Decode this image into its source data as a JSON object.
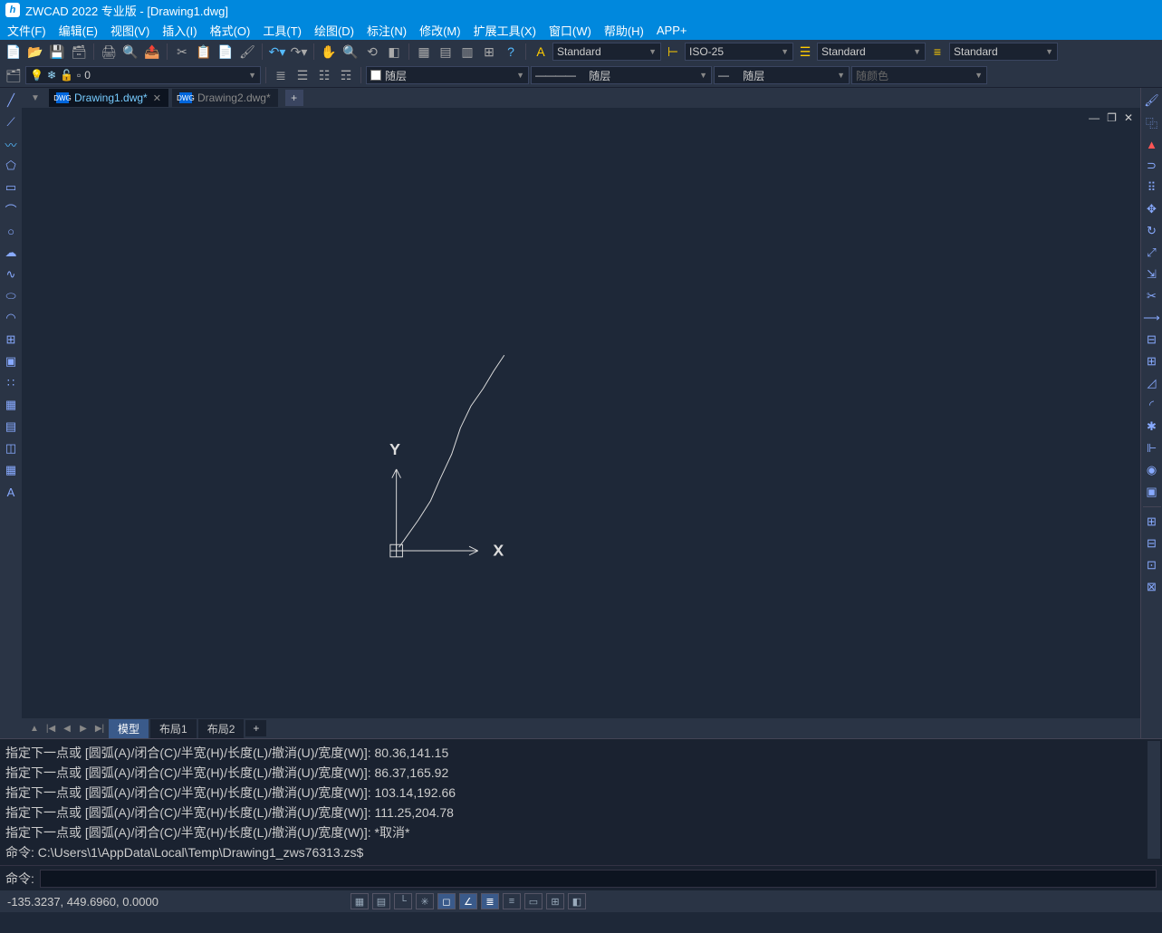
{
  "title": "ZWCAD 2022 专业版 - [Drawing1.dwg]",
  "app_initial": "h",
  "menu": [
    "文件(F)",
    "编辑(E)",
    "视图(V)",
    "插入(I)",
    "格式(O)",
    "工具(T)",
    "绘图(D)",
    "标注(N)",
    "修改(M)",
    "扩展工具(X)",
    "窗口(W)",
    "帮助(H)",
    "APP+"
  ],
  "style_dd1": "Standard",
  "style_dd2": "ISO-25",
  "style_dd3": "Standard",
  "style_dd4": "Standard",
  "layer_current": "0",
  "prop_layer": "随层",
  "prop_ltype": "随层",
  "prop_lweight": "随层",
  "prop_color": "随颜色",
  "tabs": [
    {
      "name": "Drawing1.dwg*",
      "active": true
    },
    {
      "name": "Drawing2.dwg*",
      "active": false
    }
  ],
  "ucs": {
    "x_label": "X",
    "y_label": "Y"
  },
  "layout_tabs": {
    "model": "模型",
    "l1": "布局1",
    "l2": "布局2"
  },
  "history": [
    "指定下一点或 [圆弧(A)/闭合(C)/半宽(H)/长度(L)/撤消(U)/宽度(W)]: 80.36,141.15",
    "指定下一点或 [圆弧(A)/闭合(C)/半宽(H)/长度(L)/撤消(U)/宽度(W)]: 86.37,165.92",
    "指定下一点或 [圆弧(A)/闭合(C)/半宽(H)/长度(L)/撤消(U)/宽度(W)]: 103.14,192.66",
    "指定下一点或 [圆弧(A)/闭合(C)/半宽(H)/长度(L)/撤消(U)/宽度(W)]: 111.25,204.78",
    "指定下一点或 [圆弧(A)/闭合(C)/半宽(H)/长度(L)/撤消(U)/宽度(W)]: *取消*",
    "命令: C:\\Users\\1\\AppData\\Local\\Temp\\Drawing1_zws76313.zs$"
  ],
  "cmd_prompt": "命令:",
  "coords": "-135.3237, 449.6960, 0.0000"
}
